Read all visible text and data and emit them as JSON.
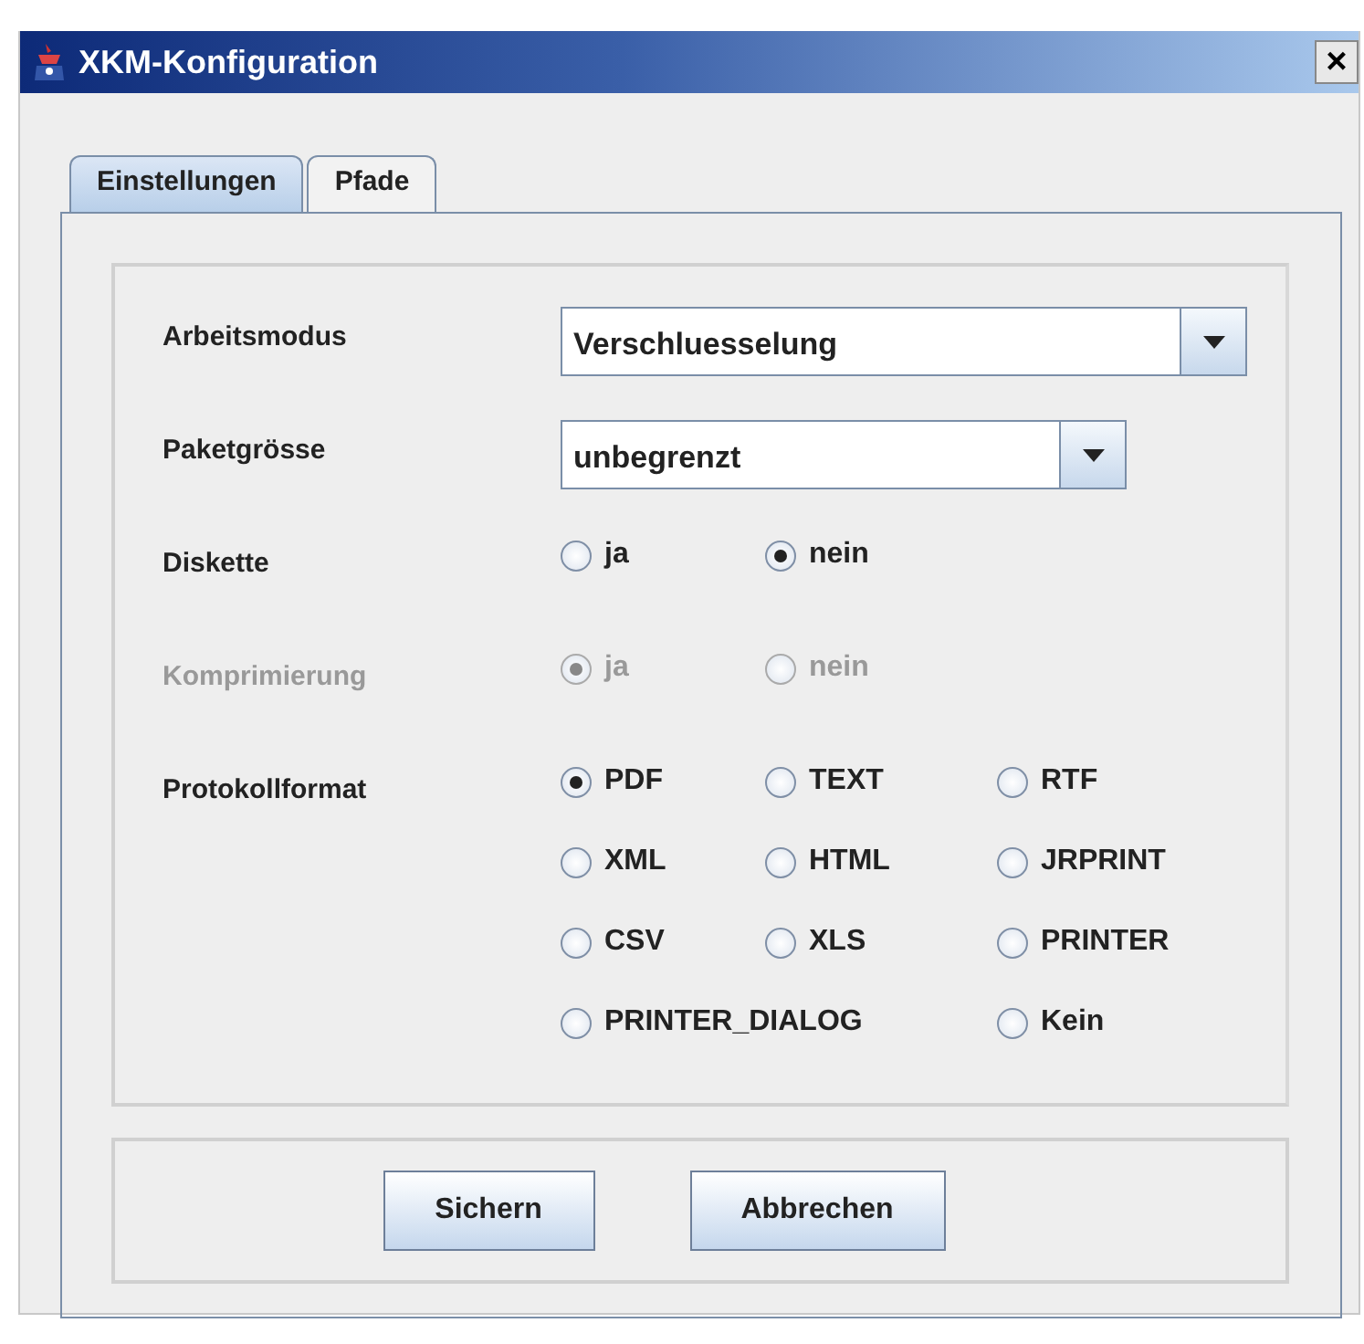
{
  "window": {
    "title": "XKM-Konfiguration",
    "close": "×"
  },
  "tabs": [
    {
      "label": "Einstellungen",
      "selected": true
    },
    {
      "label": "Pfade",
      "selected": false
    }
  ],
  "fields": [
    {
      "kind": "combo",
      "label": "Arbeitsmodus",
      "value": "Verschluesselung",
      "disabled": false
    },
    {
      "kind": "combo",
      "label": "Paketgrösse",
      "value": "unbegrenzt",
      "disabled": false
    },
    {
      "kind": "radio",
      "label": "Diskette",
      "disabled": false,
      "options": [
        {
          "label": "ja",
          "selected": false
        },
        {
          "label": "nein",
          "selected": true
        }
      ]
    },
    {
      "kind": "radio",
      "label": "Komprimierung",
      "disabled": true,
      "options": [
        {
          "label": "ja",
          "selected": true
        },
        {
          "label": "nein",
          "selected": false
        }
      ]
    },
    {
      "kind": "radio",
      "label": "Protokollformat",
      "disabled": false,
      "options": [
        {
          "label": "PDF",
          "selected": true
        },
        {
          "label": "TEXT",
          "selected": false
        },
        {
          "label": "RTF",
          "selected": false
        },
        {
          "label": "XML",
          "selected": false
        },
        {
          "label": "HTML",
          "selected": false
        },
        {
          "label": "JRPRINT",
          "selected": false
        },
        {
          "label": "CSV",
          "selected": false
        },
        {
          "label": "XLS",
          "selected": false
        },
        {
          "label": "PRINTER",
          "selected": false
        },
        {
          "label": "PRINTER_DIALOG",
          "selected": false
        },
        {
          "label": "Kein",
          "selected": false
        }
      ]
    }
  ],
  "buttons": [
    "Sichern",
    "Abbrechen"
  ]
}
